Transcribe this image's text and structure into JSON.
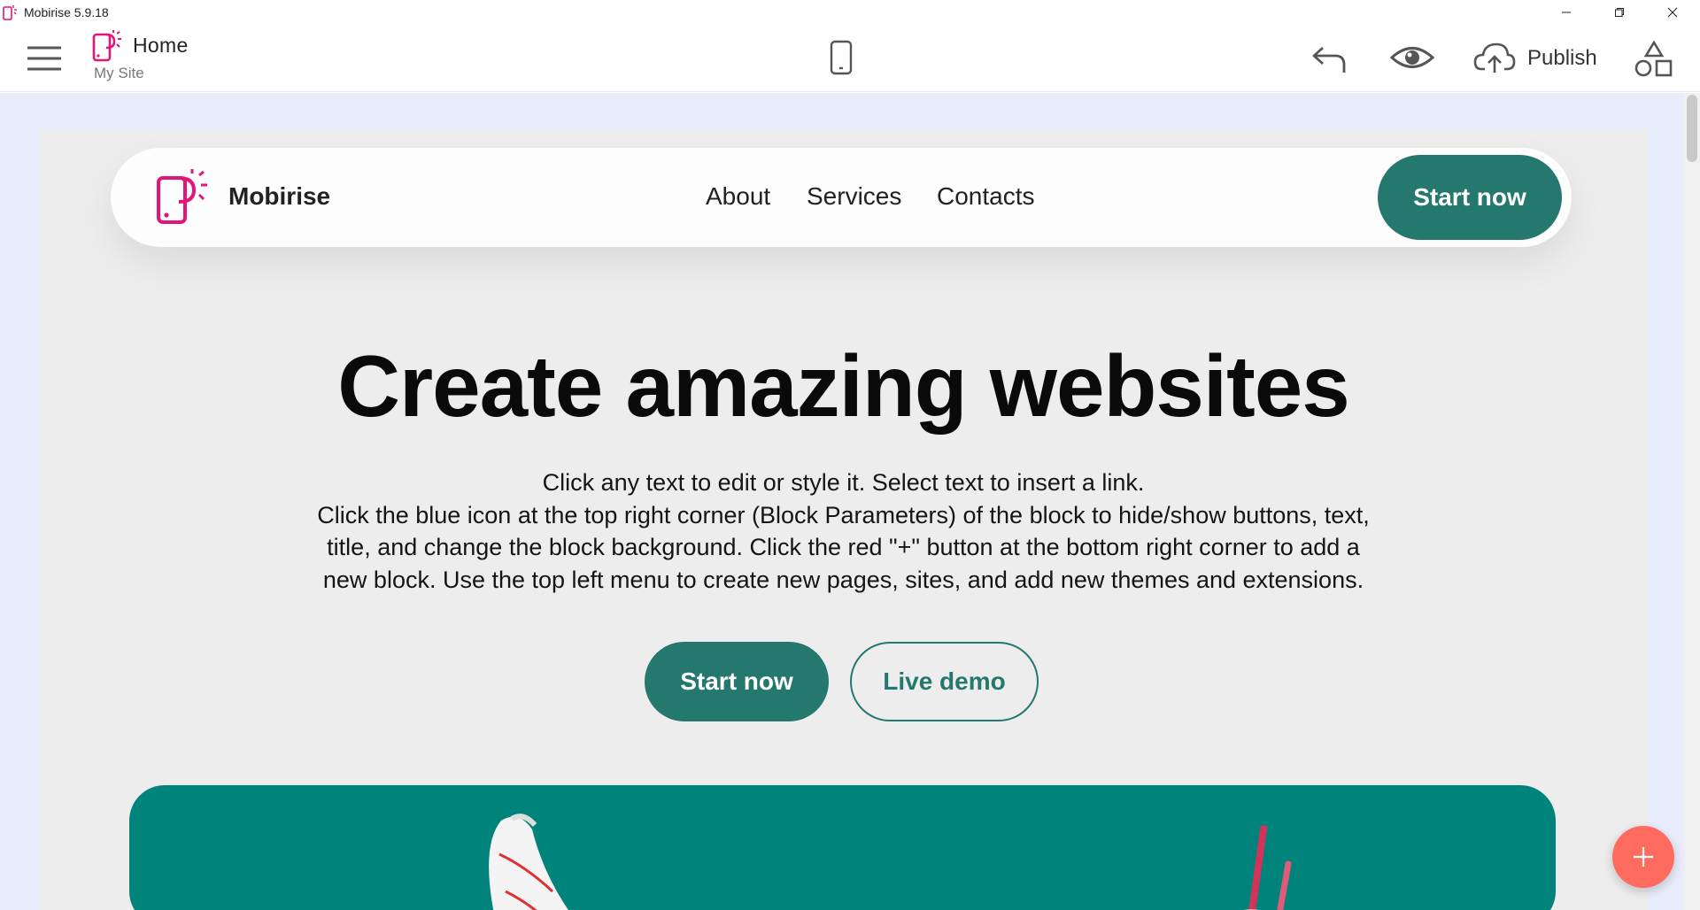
{
  "window": {
    "title": "Mobirise 5.9.18",
    "controls": [
      "minimize-icon",
      "restore-icon",
      "close-icon"
    ]
  },
  "toolbar": {
    "page_name": "Home",
    "site_name": "My Site",
    "publish_label": "Publish",
    "icons": [
      "menu-icon",
      "mobirise-logo-icon",
      "mobile-device-icon",
      "undo-icon",
      "preview-eye-icon",
      "cloud-upload-icon",
      "shapes-icon"
    ]
  },
  "site": {
    "brand": "Mobirise",
    "nav": [
      "About",
      "Services",
      "Contacts"
    ],
    "nav_button": "Start now",
    "hero": {
      "title": "Create amazing websites",
      "text": [
        "Click any text to edit or style it. Select text to insert a link.",
        "Click the blue icon at the top right corner (Block Parameters) of the block to hide/show buttons, text,",
        "title, and change the block background. Click the red \"+\" button at the bottom right corner to add a",
        "new block. Use the top left menu to create new pages, sites, and add new themes and extensions."
      ],
      "primary_button": "Start now",
      "secondary_button": "Live demo"
    }
  },
  "colors": {
    "accent": "#24786e",
    "brand_pink": "#e2157b",
    "image_bg": "#00837a",
    "add_button": "#ff6b5e",
    "canvas_bg": "#e9edfb",
    "block_bg": "#ededed"
  }
}
